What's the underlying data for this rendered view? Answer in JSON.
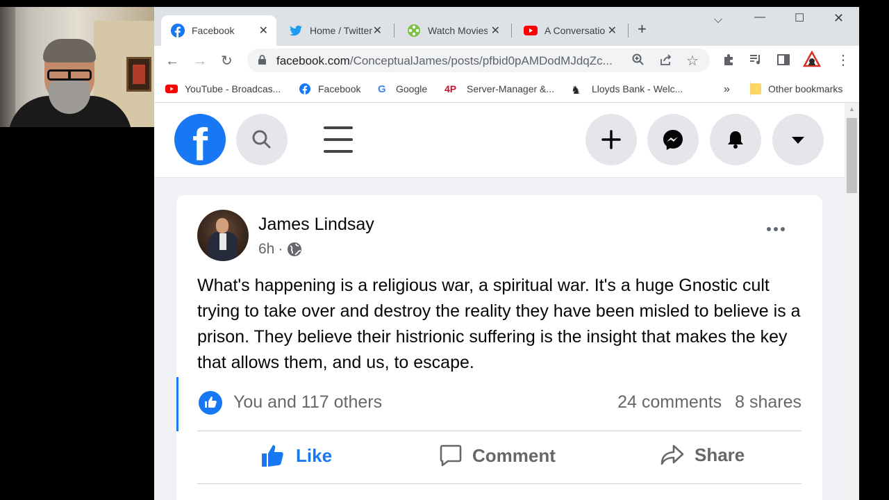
{
  "tabs": [
    {
      "label": "Facebook",
      "active": true,
      "icon": "facebook-icon"
    },
    {
      "label": "Home / Twitter",
      "active": false,
      "icon": "twitter-icon"
    },
    {
      "label": "Watch Movies",
      "active": false,
      "icon": "movie-reel-icon"
    },
    {
      "label": "A Conversation",
      "active": false,
      "icon": "youtube-icon"
    }
  ],
  "address": {
    "host": "facebook.com",
    "path": "/ConceptualJames/posts/pfbid0pAMDodMJdqZc..."
  },
  "bookmarks": [
    {
      "label": "YouTube - Broadcas...",
      "icon": "youtube-icon"
    },
    {
      "label": "Facebook",
      "icon": "facebook-icon"
    },
    {
      "label": "Google",
      "icon": "google-icon"
    },
    {
      "label": "Server-Manager &...",
      "icon": "4p-icon"
    },
    {
      "label": "Lloyds Bank - Welc...",
      "icon": "horse-icon"
    }
  ],
  "bookmarks_overflow": "»",
  "other_bookmarks": "Other bookmarks",
  "post": {
    "author": "James Lindsay",
    "time": "6h",
    "separator": "·",
    "text": "What's happening is a religious war, a spiritual war. It's a huge Gnostic cult trying to take over and destroy the reality they have been misled to believe is a prison. They believe their histrionic suffering is the insight that makes the key that allows them, and us, to escape.",
    "reactions": "You and 117 others",
    "comments": "24 comments",
    "shares": "8 shares"
  },
  "actions": {
    "like": "Like",
    "comment": "Comment",
    "share": "Share"
  },
  "colors": {
    "facebook_blue": "#1877f2",
    "page_bg": "#f0f2f5",
    "secondary_text": "#65676b"
  }
}
